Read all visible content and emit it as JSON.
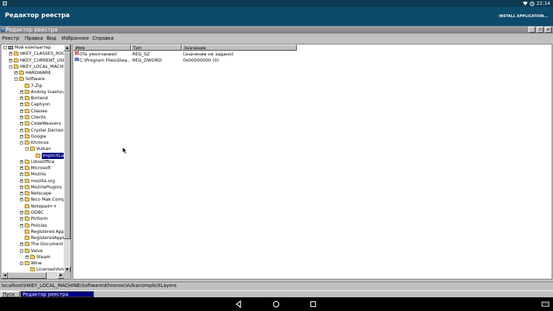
{
  "status_bar": {
    "time": "22:14"
  },
  "app_bar": {
    "title": "Редактор реестра",
    "action": "INSTALL APPLICATION..."
  },
  "window": {
    "title": "Редактор реестра",
    "menu": [
      "Реестр",
      "Правка",
      "Вид",
      "Избранное",
      "Справка"
    ]
  },
  "tree": {
    "items": [
      {
        "label": "Мой компьютер",
        "indent": 0,
        "expander": "-",
        "icon": "computer"
      },
      {
        "label": "HKEY_CLASSES_ROOT",
        "indent": 1,
        "expander": "+"
      },
      {
        "label": "HKEY_CURRENT_USER",
        "indent": 1,
        "expander": "+"
      },
      {
        "label": "HKEY_LOCAL_MACHINE",
        "indent": 1,
        "expander": "-"
      },
      {
        "label": "HARDWARE",
        "indent": 2,
        "expander": "+"
      },
      {
        "label": "Software",
        "indent": 2,
        "expander": "-"
      },
      {
        "label": "7-Zip",
        "indent": 3,
        "expander": ""
      },
      {
        "label": "Andrey Ivashov",
        "indent": 3,
        "expander": "+"
      },
      {
        "label": "Borland",
        "indent": 3,
        "expander": "+"
      },
      {
        "label": "Caphyon",
        "indent": 3,
        "expander": "+"
      },
      {
        "label": "Classes",
        "indent": 3,
        "expander": "+"
      },
      {
        "label": "Clients",
        "indent": 3,
        "expander": "+"
      },
      {
        "label": "CodeWeavers",
        "indent": 3,
        "expander": "+"
      },
      {
        "label": "Crystal Decisions",
        "indent": 3,
        "expander": "+"
      },
      {
        "label": "Google",
        "indent": 3,
        "expander": "+"
      },
      {
        "label": "Khronos",
        "indent": 3,
        "expander": "-"
      },
      {
        "label": "Vulkan",
        "indent": 4,
        "expander": "-"
      },
      {
        "label": "ImplicitLaye",
        "indent": 5,
        "expander": "",
        "selected": true
      },
      {
        "label": "LibreOffice",
        "indent": 3,
        "expander": "+"
      },
      {
        "label": "Microsoft",
        "indent": 3,
        "expander": "+"
      },
      {
        "label": "Mozilla",
        "indent": 3,
        "expander": "+"
      },
      {
        "label": "mozilla.org",
        "indent": 3,
        "expander": "+"
      },
      {
        "label": "MozillaPlugins",
        "indent": 3,
        "expander": "+"
      },
      {
        "label": "Netscape",
        "indent": 3,
        "expander": "+"
      },
      {
        "label": "Nico Mak Comput",
        "indent": 3,
        "expander": "+"
      },
      {
        "label": "Notepad++",
        "indent": 3,
        "expander": ""
      },
      {
        "label": "ODBC",
        "indent": 3,
        "expander": "+"
      },
      {
        "label": "Piriform",
        "indent": 3,
        "expander": "+"
      },
      {
        "label": "Policies",
        "indent": 3,
        "expander": "+"
      },
      {
        "label": "Registered Applic",
        "indent": 3,
        "expander": ""
      },
      {
        "label": "RegisteredApplica",
        "indent": 3,
        "expander": ""
      },
      {
        "label": "The Document Fo",
        "indent": 3,
        "expander": "+"
      },
      {
        "label": "Valve",
        "indent": 3,
        "expander": "-"
      },
      {
        "label": "Steam",
        "indent": 4,
        "expander": "+"
      },
      {
        "label": "Wine",
        "indent": 3,
        "expander": "-"
      },
      {
        "label": "LicenseInformat",
        "indent": 4,
        "expander": ""
      }
    ]
  },
  "values": {
    "columns": [
      "Имя",
      "Тип",
      "Значение"
    ],
    "rows": [
      {
        "name": "(По умолчанию)",
        "type": "REG_SZ",
        "data": "(значение не задано)",
        "kind": "sz"
      },
      {
        "name": "C:\\Program Files\\Stea...",
        "type": "REG_DWORD",
        "data": "0x00000000 (0)",
        "kind": "dword"
      }
    ]
  },
  "path": "localhost\\HKEY_LOCAL_MACHINE\\Software\\Khronos\\Vulkan\\ImplicitLayers",
  "taskbar": {
    "start": "Пуск",
    "task": "Редактор реестра"
  }
}
